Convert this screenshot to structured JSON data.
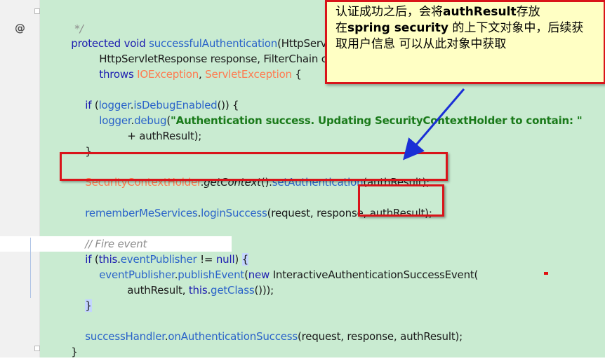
{
  "editor": {
    "code": {
      "comment_end": "*/",
      "annotation_marker": "@",
      "sig_protected": "protected",
      "sig_void": "void",
      "sig_method": "successfulAuthentication",
      "sig_params_start": "(HttpServl",
      "sig_line2": "HttpServletResponse response, FilterChain ch",
      "throws_kw": "throws",
      "exc1": "IOException",
      "exc_sep": ", ",
      "exc2": "ServletException",
      "exc_brace": " {",
      "if_kw": "if",
      "if_open": " (",
      "logger1": "logger",
      "dot1": ".",
      "isDebugEnabled": "isDebugEnabled",
      "if_close": "()) {",
      "logger2": "logger",
      "dot2": ".",
      "debug": "debug",
      "debug_open": "(",
      "debug_string": "\"Authentication success. Updating SecurityContextHolder to contain: \"",
      "debug_concat": "+ authResult);",
      "close_if1": "}",
      "sch_class": "SecurityContextHolder",
      "sch_dot": ".",
      "getContext": "getContext",
      "getContext_paren": "().",
      "setAuthentication": "setAuthentication",
      "setAuth_args": "(authResult);",
      "rememberMe": "rememberMeServices",
      "rm_dot": ".",
      "loginSuccess": "loginSuccess",
      "loginSuccess_args": "(request, response, authResult);",
      "fire_comment": "// Fire event",
      "if2_kw": "if",
      "if2_open": " (",
      "this_kw": "this",
      "if2_dot": ".",
      "eventPublisher_field": "eventPublisher",
      "if2_rest": " != ",
      "null_kw": "null",
      "if2_end": ") ",
      "if2_brace": "{",
      "eventPublisher": "eventPublisher",
      "ep_dot": ".",
      "publishEvent": "publishEvent",
      "pe_open": "(",
      "new_kw": "new",
      "event_class": " InteractiveAuthenticationSuccessEvent(",
      "authResult_arg": "authResult, ",
      "this2_kw": "this",
      "this2_dot": ".",
      "getClass": "getClass",
      "getClass_end": "()));",
      "close_if2": "}",
      "successHandler": "successHandler",
      "sh_dot": ".",
      "onAuthSuccess": "onAuthenticationSuccess",
      "onAuth_args": "(request, response, authResult);",
      "close_method": "}"
    },
    "colors": {
      "code_background": "#c9ebd1",
      "keyword": "#1c1cb0",
      "method": "#2a63c9",
      "class_ref": "#ff7a4f",
      "string": "#1a7a1a",
      "comment": "#8c8c8c",
      "highlight_box": "#d9141a",
      "callout_background": "#ffffc4",
      "arrow": "#1a2fd6"
    }
  },
  "callout": {
    "line1_pre": "认证成功之后，会将",
    "line1_bold": "authResult",
    "line1_post": "存放",
    "line2_pre": "在",
    "line2_bold": "spring security",
    "line2_post": " 的上下文对象中，后续获",
    "line3": "取用户信息 可以从此对象中获取"
  }
}
